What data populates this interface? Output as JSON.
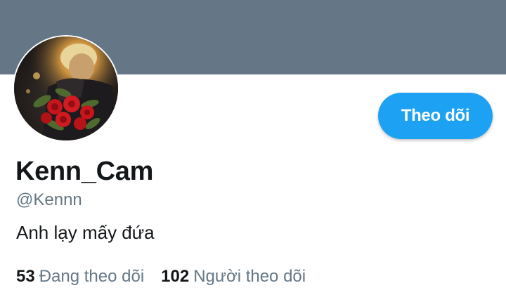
{
  "profile": {
    "display_name": "Kenn_Cam",
    "handle": "@Kennn",
    "bio": "Anh lạy mấy đứa",
    "follow_button_label": "Theo dõi",
    "avatar_icon": "profile-photo-person-with-red-roses"
  },
  "stats": {
    "following_count": "53",
    "following_label": "Đang theo dõi",
    "followers_count": "102",
    "followers_label": "Người theo dõi"
  },
  "colors": {
    "banner": "#657786",
    "accent": "#1da1f2",
    "text_primary": "#14171a",
    "text_secondary": "#657786"
  }
}
